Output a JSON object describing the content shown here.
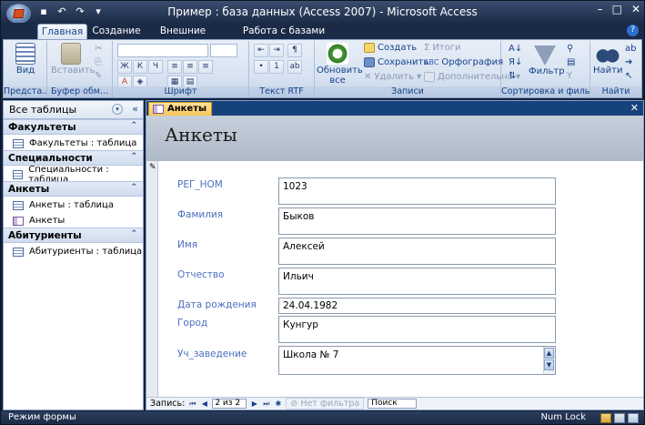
{
  "window": {
    "title": "Пример : база данных (Access 2007) - Microsoft Access"
  },
  "ribbon_tabs": [
    "Главная",
    "Создание",
    "Внешние данные",
    "Работа с базами данных"
  ],
  "ribbon": {
    "view_label": "Вид",
    "paste_label": "Вставить",
    "refresh_label": "Обновить все",
    "create_label": "Создать",
    "save_label": "Сохранить",
    "delete_label": "Удалить",
    "totals_label": "Итоги",
    "spelling_label": "Орфография",
    "more_label": "Дополнительно",
    "filter_label": "Фильтр",
    "find_label": "Найти",
    "groups": [
      "Предста...",
      "Буфер обм...",
      "Шрифт",
      "Текст RTF",
      "Записи",
      "Сортировка и филь...",
      "Найти"
    ]
  },
  "nav": {
    "header": "Все таблицы",
    "groups": [
      {
        "name": "Факультеты",
        "items": [
          {
            "label": "Факультеты : таблица",
            "icon": "table-icon"
          }
        ]
      },
      {
        "name": "Специальности",
        "items": [
          {
            "label": "Специальности : таблица",
            "icon": "table-icon"
          }
        ]
      },
      {
        "name": "Анкеты",
        "items": [
          {
            "label": "Анкеты : таблица",
            "icon": "table-icon"
          },
          {
            "label": "Анкеты",
            "icon": "form-icon"
          }
        ]
      },
      {
        "name": "Абитуриенты",
        "items": [
          {
            "label": "Абитуриенты : таблица",
            "icon": "table-icon"
          }
        ]
      }
    ]
  },
  "document": {
    "tab_label": "Анкеты",
    "form_title": "Анкеты",
    "fields": [
      {
        "label": "РЕГ_НОМ",
        "value": "1023"
      },
      {
        "label": "Фамилия",
        "value": "Быков"
      },
      {
        "label": "Имя",
        "value": "Алексей"
      },
      {
        "label": "Отчество",
        "value": "Ильич"
      },
      {
        "label": "Дата рождения",
        "value": "24.04.1982"
      },
      {
        "label": "Город",
        "value": "Кунгур"
      },
      {
        "label": "Уч_заведение",
        "value": "Школа № 7"
      }
    ]
  },
  "record_nav": {
    "label": "Запись:",
    "position": "2 из 2",
    "filter": "Нет фильтра",
    "search": "Поиск"
  },
  "status": {
    "left": "Режим формы",
    "right": "Num Lock"
  },
  "colors": {
    "accent": "#15428b",
    "label_blue": "#4a6fbf",
    "doc_tab": "#f7c559"
  }
}
